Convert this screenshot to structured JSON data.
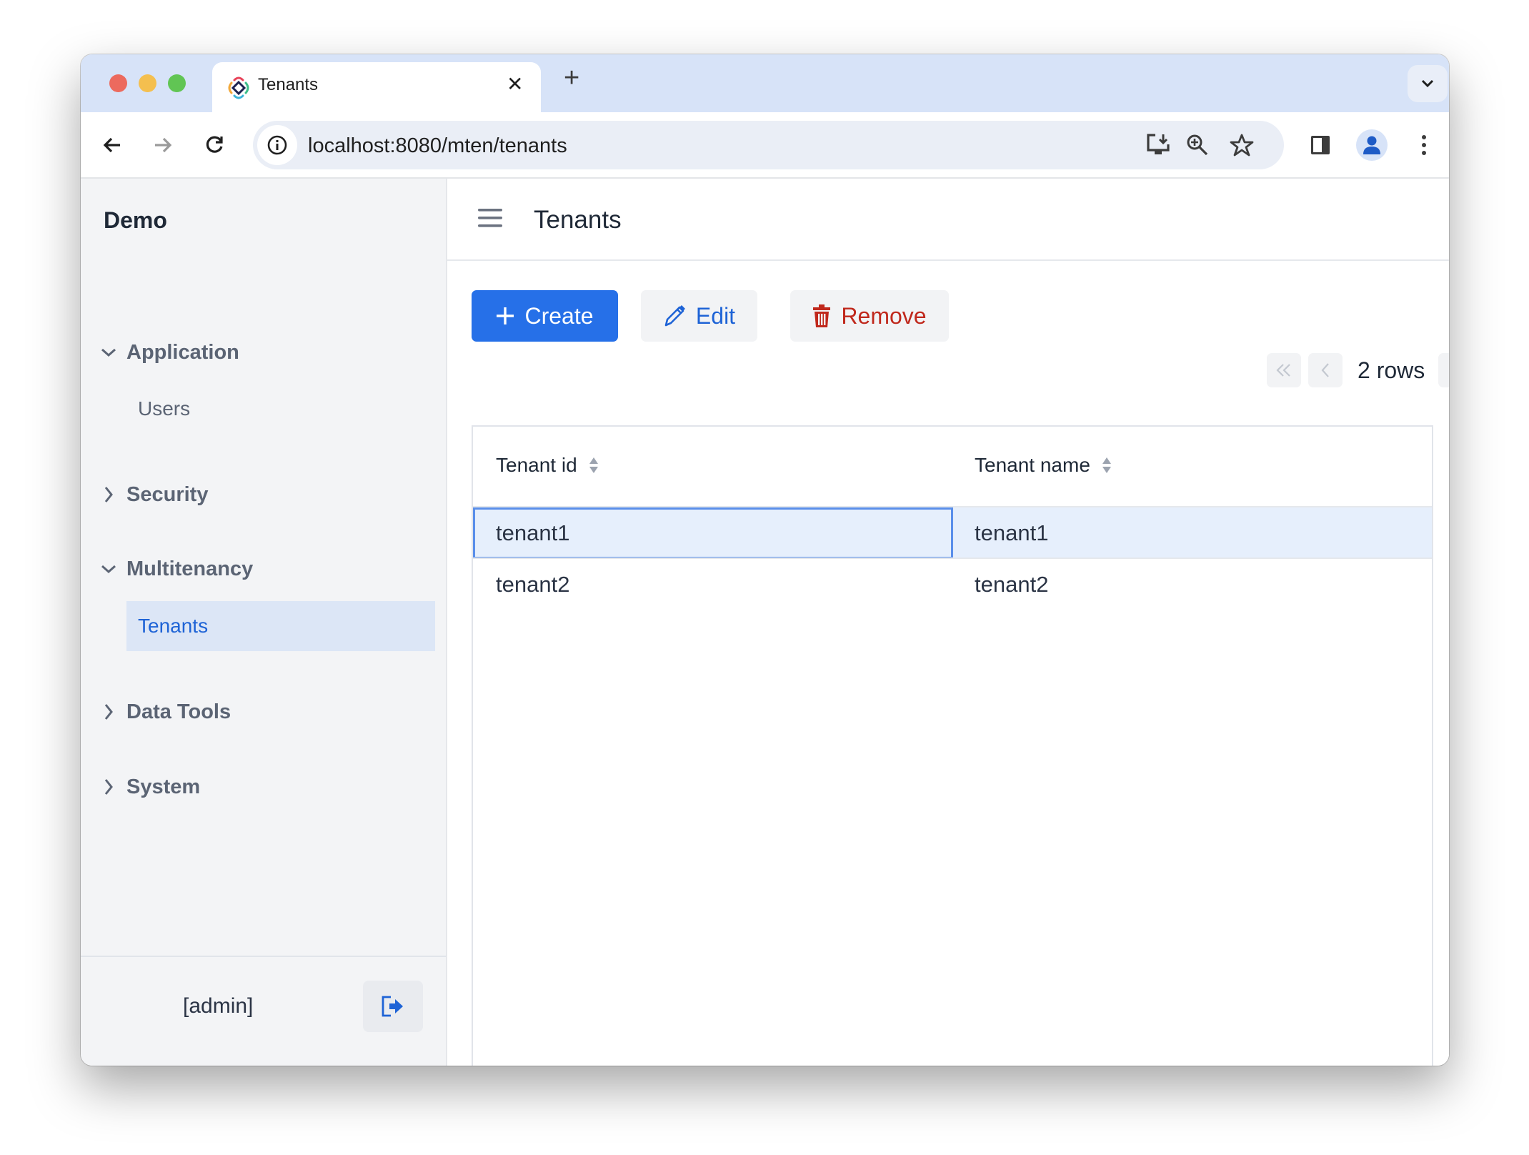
{
  "browser": {
    "tab": {
      "title": "Tenants",
      "favicon": "app-logo-icon",
      "close_icon": "close-icon"
    },
    "new_tab_icon": "plus-icon",
    "tab_list_icon": "chevron-down-icon",
    "url": "localhost:8080/mten/tenants",
    "toolbar_icons": [
      "back-icon",
      "forward-icon",
      "reload-icon",
      "site-info-icon",
      "install-app-icon",
      "zoom-icon",
      "bookmark-star-icon",
      "side-panel-icon",
      "profile-icon",
      "menu-icon"
    ],
    "traffic_lights": {
      "close": "#EC6A5E",
      "minimize": "#F4BF4F",
      "zoom": "#61C554"
    }
  },
  "sidebar": {
    "app_title": "Demo",
    "groups": [
      {
        "label": "Application",
        "expanded": true,
        "items": [
          {
            "label": "Users",
            "active": false
          }
        ]
      },
      {
        "label": "Security",
        "expanded": false,
        "items": []
      },
      {
        "label": "Multitenancy",
        "expanded": true,
        "items": [
          {
            "label": "Tenants",
            "active": true
          }
        ]
      },
      {
        "label": "Data Tools",
        "expanded": false,
        "items": []
      },
      {
        "label": "System",
        "expanded": false,
        "items": []
      }
    ],
    "footer": {
      "user": "[admin]",
      "logout_icon": "logout-icon"
    }
  },
  "main": {
    "title": "Tenants",
    "menu_icon": "hamburger-icon",
    "actions": {
      "create": "Create",
      "edit": "Edit",
      "remove": "Remove"
    },
    "pagination": {
      "label": "2 rows"
    },
    "table": {
      "columns": [
        "Tenant id",
        "Tenant name"
      ],
      "rows": [
        {
          "id": "tenant1",
          "name": "tenant1",
          "selected": true
        },
        {
          "id": "tenant2",
          "name": "tenant2",
          "selected": false
        }
      ]
    }
  },
  "colors": {
    "primary": "#2670E8",
    "danger": "#C0281C",
    "link": "#1E63D6",
    "sidebar_bg": "#F3F4F6",
    "selected_row": "#E6EFFC",
    "tabstrip": "#D7E3F8"
  }
}
